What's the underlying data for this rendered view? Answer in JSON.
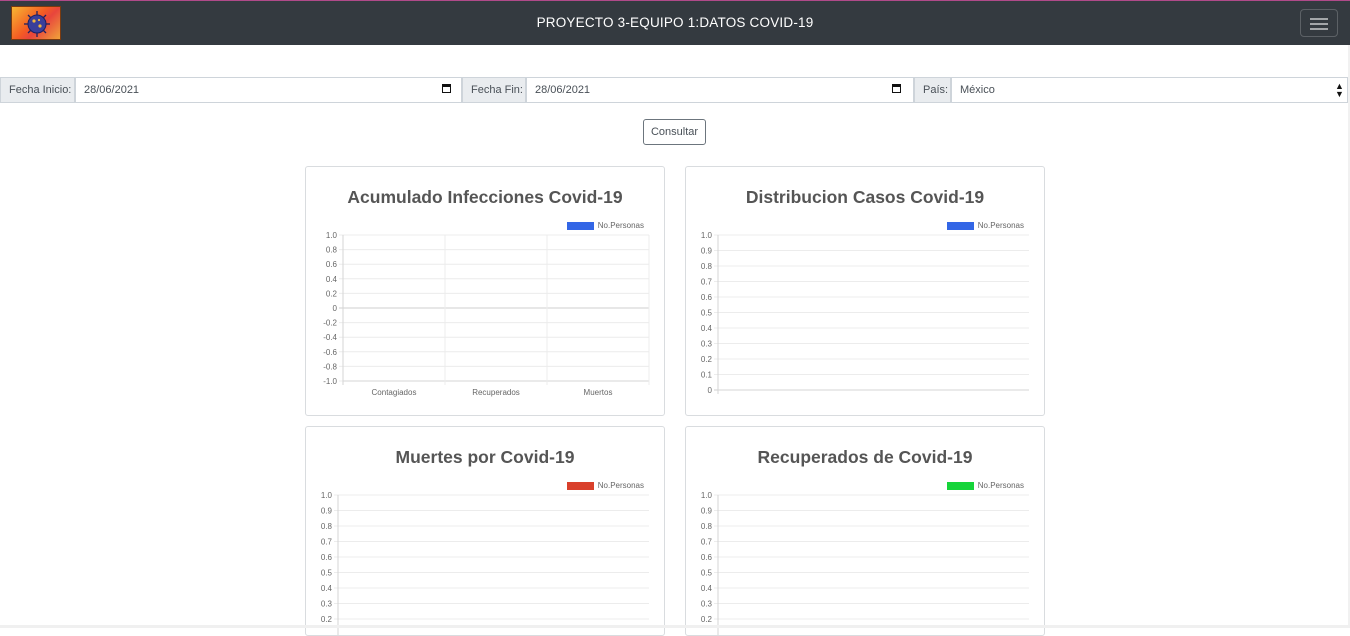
{
  "navbar": {
    "title": "PROYECTO 3-EQUIPO 1:DATOS COVID-19",
    "logo_icon": "virus-logo-icon",
    "menu_icon": "hamburger-menu-icon"
  },
  "filters": {
    "start_label": "Fecha Inicio:",
    "start_value": "28/06/2021",
    "end_label": "Fecha Fin:",
    "end_value": "28/06/2021",
    "country_label": "País:",
    "country_value": "México"
  },
  "consult_button": "Consultar",
  "chart_data": [
    {
      "type": "bar",
      "title": "Acumulado Infecciones Covid-19",
      "categories": [
        "Contagiados",
        "Recuperados",
        "Muertos"
      ],
      "series": [
        {
          "name": "No.Personas",
          "values": [],
          "color": "#3366e6"
        }
      ],
      "yticks": [
        "1.0",
        "0.8",
        "0.6",
        "0.4",
        "0.2",
        "0",
        "-0.2",
        "-0.4",
        "-0.6",
        "-0.8",
        "-1.0"
      ],
      "ylim": [
        -1.0,
        1.0
      ],
      "grid": true,
      "legend": "top-right"
    },
    {
      "type": "line",
      "title": "Distribucion Casos Covid-19",
      "categories": [],
      "series": [
        {
          "name": "No.Personas",
          "values": [],
          "color": "#3366e6"
        }
      ],
      "yticks": [
        "1.0",
        "0.9",
        "0.8",
        "0.7",
        "0.6",
        "0.5",
        "0.4",
        "0.3",
        "0.2",
        "0.1",
        "0"
      ],
      "ylim": [
        0,
        1.0
      ],
      "grid": true,
      "legend": "top-right"
    },
    {
      "type": "line",
      "title": "Muertes por Covid-19",
      "categories": [],
      "series": [
        {
          "name": "No.Personas",
          "values": [],
          "color": "#d9402b"
        }
      ],
      "yticks": [
        "1.0",
        "0.9",
        "0.8",
        "0.7",
        "0.6",
        "0.5",
        "0.4",
        "0.3",
        "0.2"
      ],
      "ylim": [
        0,
        1.0
      ],
      "grid": true,
      "legend": "top-right"
    },
    {
      "type": "line",
      "title": "Recuperados de Covid-19",
      "categories": [],
      "series": [
        {
          "name": "No.Personas",
          "values": [],
          "color": "#16d43a"
        }
      ],
      "yticks": [
        "1.0",
        "0.9",
        "0.8",
        "0.7",
        "0.6",
        "0.5",
        "0.4",
        "0.3",
        "0.2"
      ],
      "ylim": [
        0,
        1.0
      ],
      "grid": true,
      "legend": "top-right"
    }
  ]
}
